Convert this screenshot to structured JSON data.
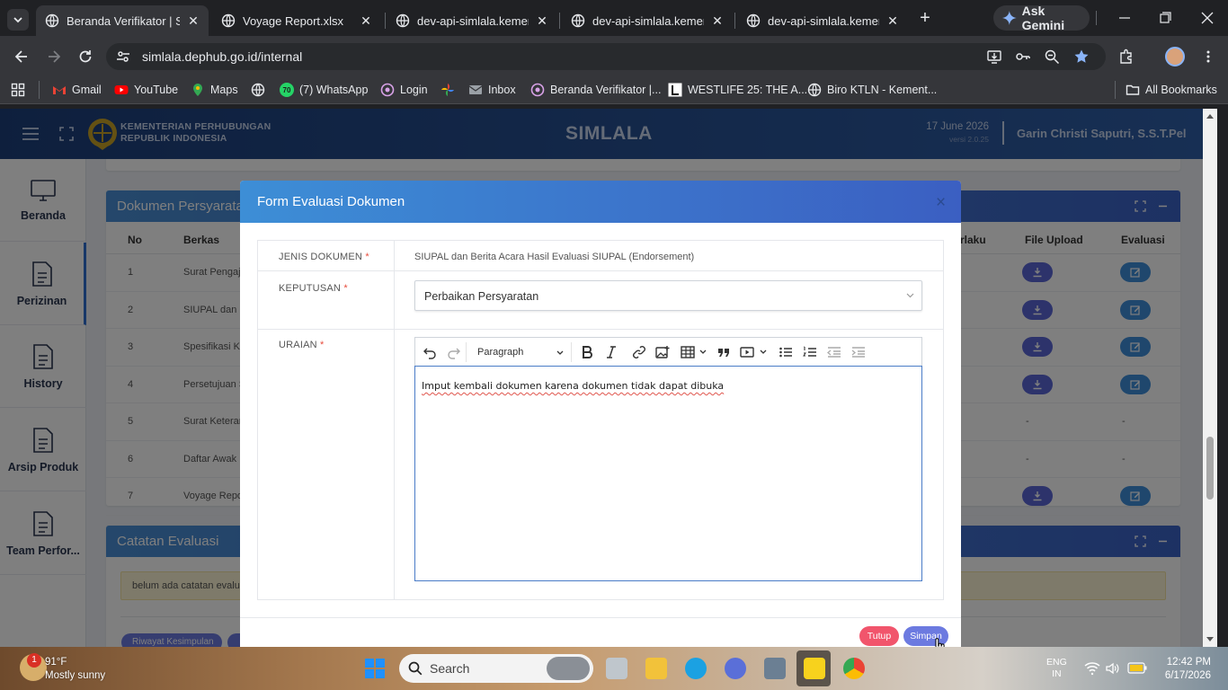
{
  "browser": {
    "tabs": [
      {
        "title": "Beranda Verifikator | Si",
        "active": true
      },
      {
        "title": "Voyage Report.xlsx",
        "active": false
      },
      {
        "title": "dev-api-simlala.kemenh",
        "active": false
      },
      {
        "title": "dev-api-simlala.kemenh",
        "active": false
      },
      {
        "title": "dev-api-simlala.kemenh",
        "active": false
      }
    ],
    "gemini_label": "Ask Gemini",
    "url": "simlala.dephub.go.id/internal",
    "bookmarks": [
      "Gmail",
      "YouTube",
      "Maps",
      "(7) WhatsApp",
      "Login",
      "Inbox",
      "Beranda Verifikator |...",
      "WESTLIFE 25: THE A...",
      "Biro KTLN - Kement..."
    ],
    "whatsapp_badge": "70",
    "all_bookmarks": "All Bookmarks"
  },
  "header": {
    "org_line1": "KEMENTERIAN PERHUBUNGAN",
    "org_line2": "REPUBLIK INDONESIA",
    "app_title": "SIMLALA",
    "date": "17 June 2026",
    "version": "versi 2.0.25",
    "user_name": "Garin Christi Saputri, S.S.T.Pel"
  },
  "sidebar": {
    "items": [
      {
        "label": "Beranda",
        "icon": "monitor-icon"
      },
      {
        "label": "Perizinan",
        "icon": "document-icon",
        "active": true
      },
      {
        "label": "History",
        "icon": "document-icon"
      },
      {
        "label": "Arsip Produk",
        "icon": "document-icon"
      },
      {
        "label": "Team Perfor...",
        "icon": "document-icon"
      }
    ]
  },
  "documents_card": {
    "title": "Dokumen Persyaratan",
    "columns": [
      "No",
      "Berkas",
      "rlaku",
      "File Upload",
      "Evaluasi"
    ],
    "rows": [
      {
        "no": "1",
        "berkas": "Surat Pengaj",
        "file": true,
        "eval": true
      },
      {
        "no": "2",
        "berkas": "SIUPAL dan B",
        "file": true,
        "eval": true
      },
      {
        "no": "3",
        "berkas": "Spesifikasi Ka",
        "file": true,
        "eval": true
      },
      {
        "no": "4",
        "berkas": "Persetujuan S",
        "file": true,
        "eval": true
      },
      {
        "no": "5",
        "berkas": "Surat Keterar",
        "file": false,
        "eval": false
      },
      {
        "no": "6",
        "berkas": "Daftar Awak",
        "file": false,
        "eval": false
      },
      {
        "no": "7",
        "berkas": "Voyage Repo",
        "file": true,
        "eval": true
      }
    ],
    "dash": "-"
  },
  "evaluation_card": {
    "title": "Catatan Evaluasi",
    "note": "belum ada catatan evalu",
    "history_button": "Riwayat Kesimpulan"
  },
  "modal": {
    "title": "Form Evaluasi Dokumen",
    "close": "×",
    "fields": {
      "jenis_label": "JENIS DOKUMEN",
      "jenis_value": "SIUPAL dan Berita Acara Hasil Evaluasi SIUPAL (Endorsement)",
      "keputusan_label": "KEPUTUSAN",
      "keputusan_value": "Perbaikan Persyaratan",
      "uraian_label": "URAIAN",
      "required_mark": "*"
    },
    "editor": {
      "paragraph_style": "Paragraph",
      "content": "Imput kembali dokumen karena dokumen tidak dapat dibuka"
    },
    "buttons": {
      "cancel": "Tutup",
      "save": "Simpan"
    },
    "colors": {
      "cancel": "#f1556c",
      "save": "#6c7ae0"
    }
  },
  "taskbar": {
    "weather_temp": "91°F",
    "weather_desc": "Mostly sunny",
    "weather_badge": "1",
    "search_placeholder": "Search",
    "lang_top": "ENG",
    "lang_bottom": "IN",
    "time": "12:42 PM",
    "date": "6/17/2026"
  }
}
